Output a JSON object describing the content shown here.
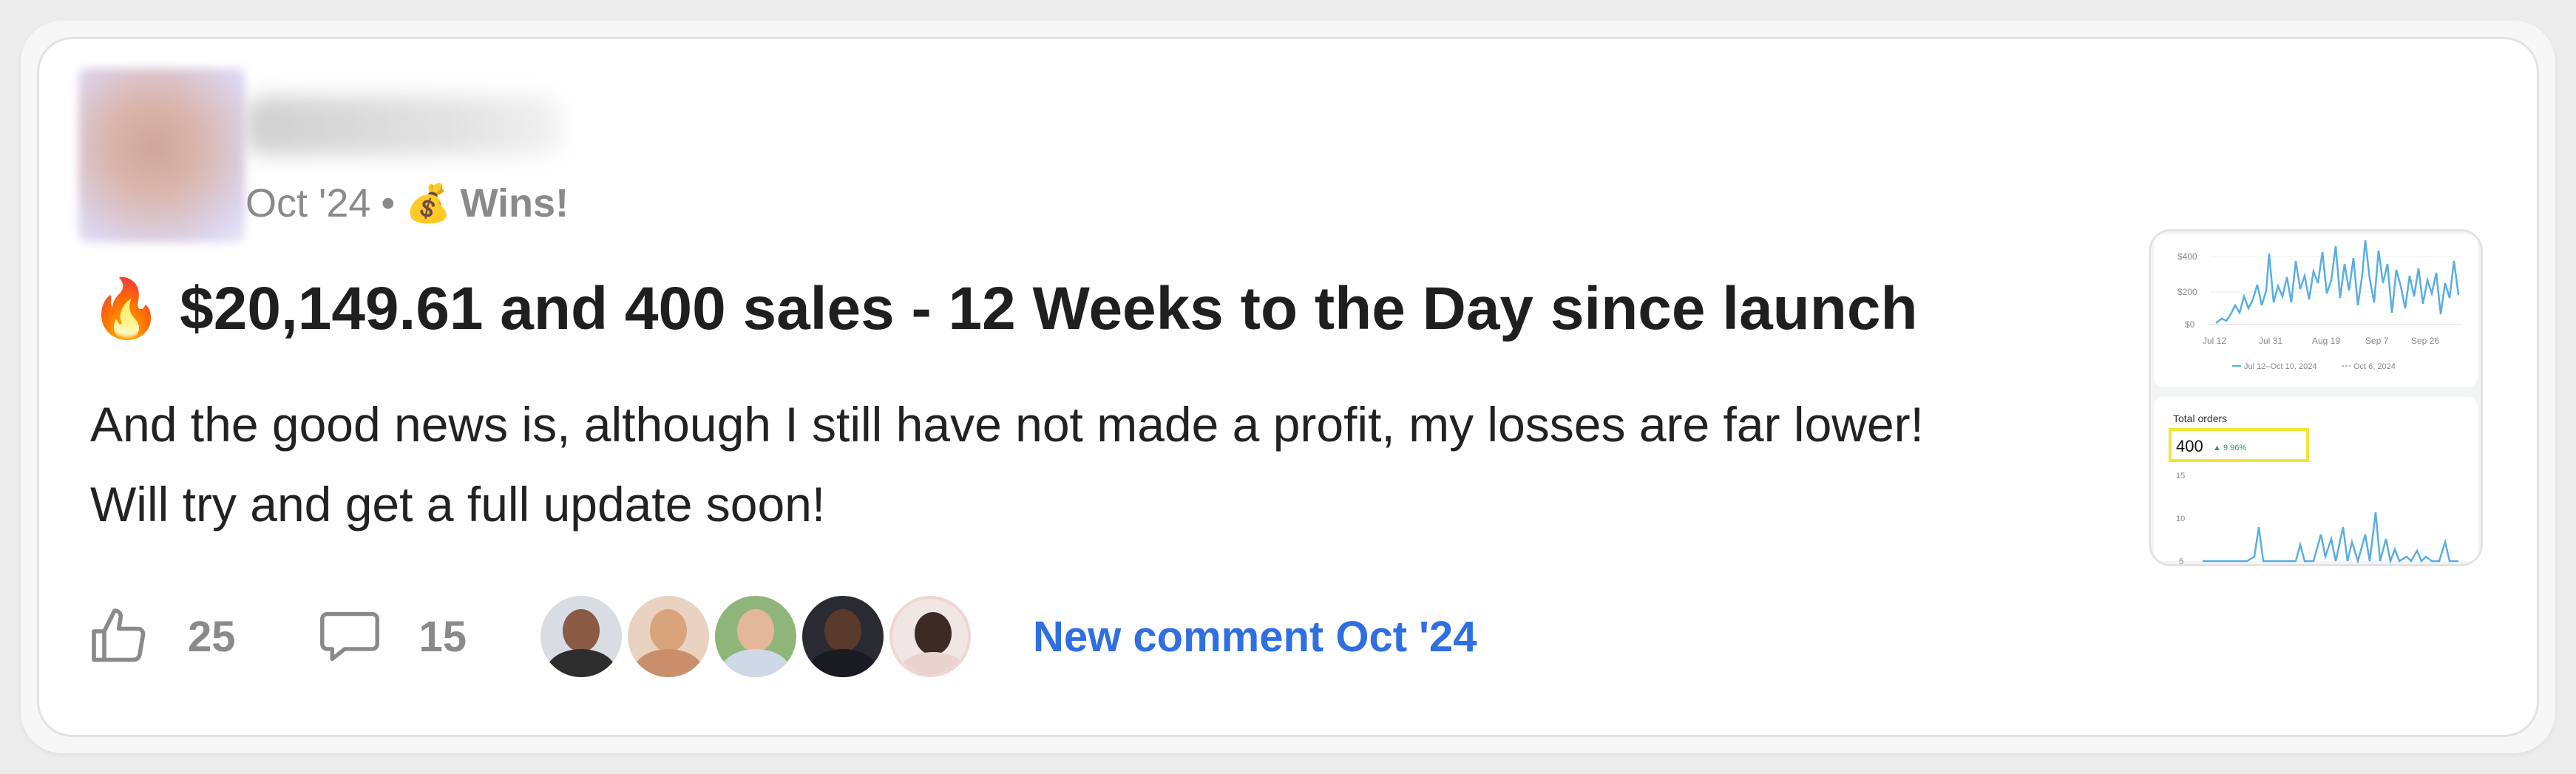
{
  "post": {
    "date": "Oct '24",
    "separator": "•",
    "category_icon": "💰",
    "category": "Wins!",
    "title_icon": "🔥",
    "title": "$20,149.61 and 400 sales - 12 Weeks to the Day since launch",
    "body_line1": "And the good news is, although I still have not made a profit, my losses are far lower!",
    "body_line2": "Will try and get a full update soon!"
  },
  "thumbnail": {
    "y_ticks": [
      "$400",
      "$200",
      "$0"
    ],
    "x_ticks": [
      "Jul 12",
      "Jul 31",
      "Aug 19",
      "Sep 7",
      "Sep 26"
    ],
    "legend_current": "Jul 12–Oct 10, 2024",
    "legend_previous": "Oct 6, 2024",
    "orders_label": "Total orders",
    "orders_value": "400",
    "orders_change": "▲ 9.96%",
    "orders_ticks": [
      "15",
      "10",
      "5"
    ]
  },
  "actions": {
    "likes": "25",
    "comments": "15",
    "new_comment": "New comment Oct '24"
  },
  "colors": {
    "accent_link": "#2f6fe0",
    "chart_line": "#5aaee0",
    "highlight_box": "#f2e53a",
    "muted_text": "#8a8a8a"
  },
  "icons": [
    "thumbs-up-icon",
    "comment-bubble-icon",
    "money-bag-icon",
    "fire-icon"
  ]
}
